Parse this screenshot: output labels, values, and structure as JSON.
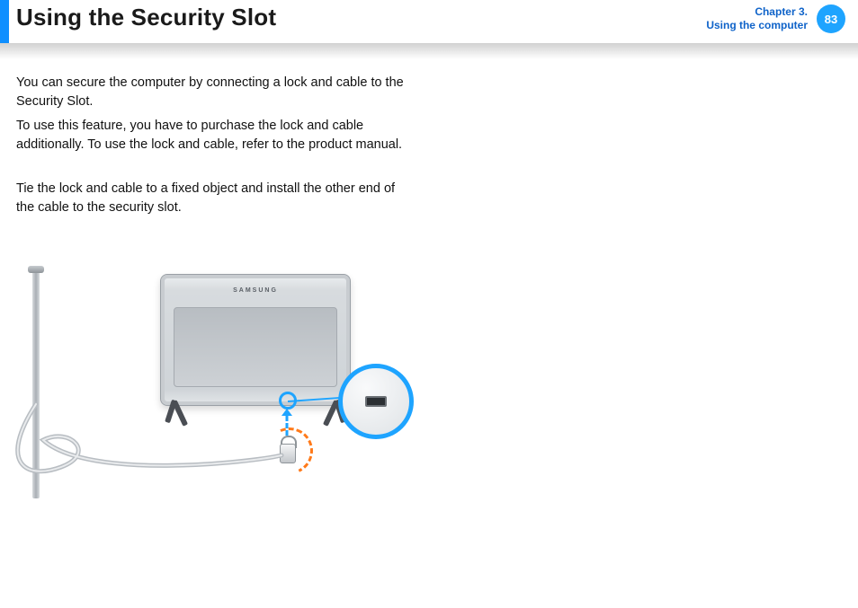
{
  "header": {
    "title": "Using the Security Slot",
    "chapter_line1": "Chapter 3.",
    "chapter_line2": "Using the computer",
    "page_number": "83"
  },
  "body": {
    "para1": "You can secure the computer by connecting a lock and cable to the Security Slot.",
    "para2": "To use this feature, you have to purchase the lock and cable additionally. To use the lock and cable, refer to the product manual.",
    "para3": "Tie the lock and cable to a fixed object and install the other end of the cable to the security slot."
  },
  "illustration": {
    "monitor_brand": "SAMSUNG"
  }
}
